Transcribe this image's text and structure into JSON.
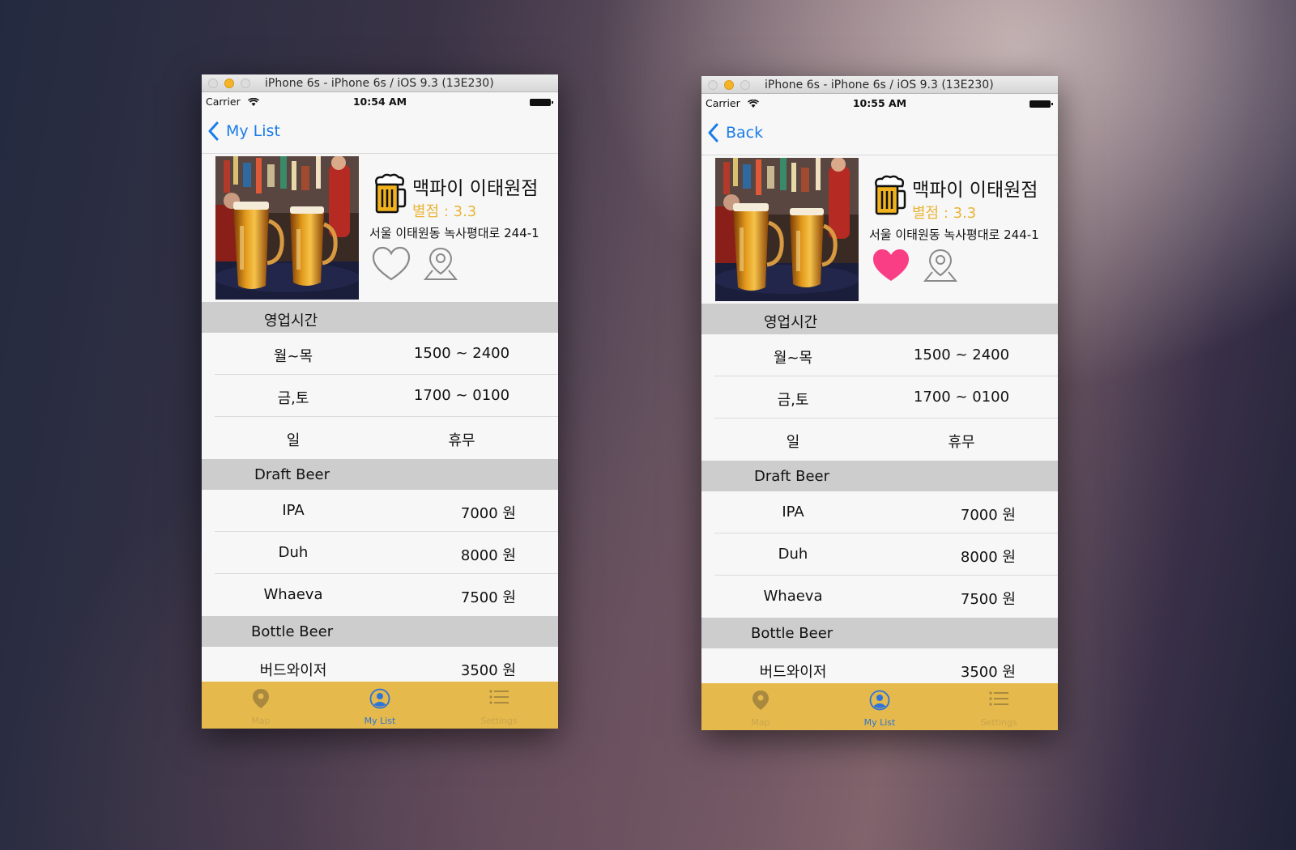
{
  "colors": {
    "tab_bar": "#e5b94b",
    "rating": "#e9b535",
    "link": "#1a7de8",
    "heart_filled": "#f93e86"
  },
  "screens": [
    {
      "window_title": "iPhone 6s - iPhone 6s / iOS 9.3 (13E230)",
      "carrier": "Carrier",
      "time": "10:54 AM",
      "back_label": "My List",
      "favorited": false,
      "shop_name": "맥파이 이태원점",
      "rating": "별점 : 3.3",
      "address": "서울 이태원동 녹사평대로 244-1",
      "hours_header": "영업시간",
      "hours": [
        {
          "day": "월~목",
          "time": "1500 ~ 2400"
        },
        {
          "day": "금,토",
          "time": "1700 ~ 0100"
        },
        {
          "day": "일",
          "time": "휴무"
        }
      ],
      "draft_header": "Draft Beer",
      "draft": [
        {
          "name": "IPA",
          "price": "7000 원"
        },
        {
          "name": "Duh",
          "price": "8000 원"
        },
        {
          "name": "Whaeva",
          "price": "7500 원"
        }
      ],
      "bottle_header": "Bottle Beer",
      "bottle": [
        {
          "name": "버드와이저",
          "price": "3500 원"
        }
      ],
      "tabs": [
        {
          "label": "Map",
          "icon": "map-pin-icon",
          "active": false
        },
        {
          "label": "My List",
          "icon": "person-icon",
          "active": true
        },
        {
          "label": "Settings",
          "icon": "list-icon",
          "active": false
        }
      ]
    },
    {
      "window_title": "iPhone 6s - iPhone 6s / iOS 9.3 (13E230)",
      "carrier": "Carrier",
      "time": "10:55 AM",
      "back_label": "Back",
      "favorited": true,
      "shop_name": "맥파이 이태원점",
      "rating": "별점 : 3.3",
      "address": "서울 이태원동 녹사평대로 244-1",
      "hours_header": "영업시간",
      "hours": [
        {
          "day": "월~목",
          "time": "1500 ~ 2400"
        },
        {
          "day": "금,토",
          "time": "1700 ~ 0100"
        },
        {
          "day": "일",
          "time": "휴무"
        }
      ],
      "draft_header": "Draft Beer",
      "draft": [
        {
          "name": "IPA",
          "price": "7000 원"
        },
        {
          "name": "Duh",
          "price": "8000 원"
        },
        {
          "name": "Whaeva",
          "price": "7500 원"
        }
      ],
      "bottle_header": "Bottle Beer",
      "bottle": [
        {
          "name": "버드와이저",
          "price": "3500 원"
        }
      ],
      "tabs": [
        {
          "label": "Map",
          "icon": "map-pin-icon",
          "active": false
        },
        {
          "label": "My List",
          "icon": "person-icon",
          "active": true
        },
        {
          "label": "Settings",
          "icon": "list-icon",
          "active": false
        }
      ]
    }
  ]
}
